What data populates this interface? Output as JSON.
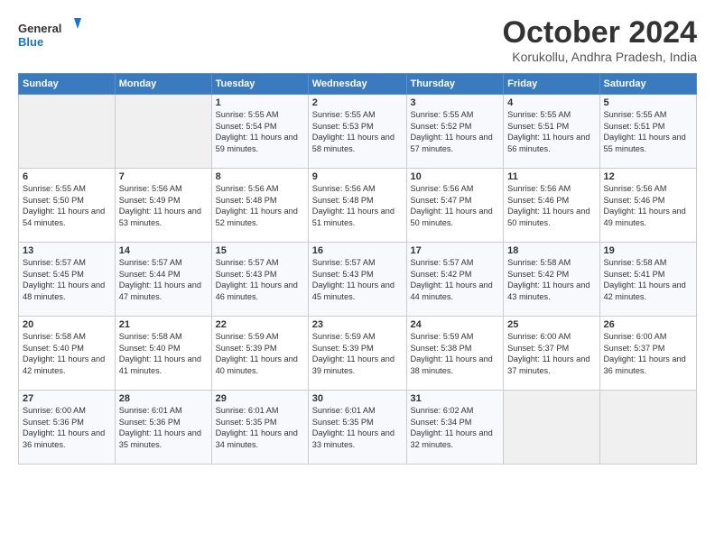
{
  "header": {
    "logo_line1": "General",
    "logo_line2": "Blue",
    "month": "October 2024",
    "location": "Korukollu, Andhra Pradesh, India"
  },
  "days_of_week": [
    "Sunday",
    "Monday",
    "Tuesday",
    "Wednesday",
    "Thursday",
    "Friday",
    "Saturday"
  ],
  "weeks": [
    [
      {
        "num": "",
        "info": ""
      },
      {
        "num": "",
        "info": ""
      },
      {
        "num": "1",
        "info": "Sunrise: 5:55 AM\nSunset: 5:54 PM\nDaylight: 11 hours and 59 minutes."
      },
      {
        "num": "2",
        "info": "Sunrise: 5:55 AM\nSunset: 5:53 PM\nDaylight: 11 hours and 58 minutes."
      },
      {
        "num": "3",
        "info": "Sunrise: 5:55 AM\nSunset: 5:52 PM\nDaylight: 11 hours and 57 minutes."
      },
      {
        "num": "4",
        "info": "Sunrise: 5:55 AM\nSunset: 5:51 PM\nDaylight: 11 hours and 56 minutes."
      },
      {
        "num": "5",
        "info": "Sunrise: 5:55 AM\nSunset: 5:51 PM\nDaylight: 11 hours and 55 minutes."
      }
    ],
    [
      {
        "num": "6",
        "info": "Sunrise: 5:55 AM\nSunset: 5:50 PM\nDaylight: 11 hours and 54 minutes."
      },
      {
        "num": "7",
        "info": "Sunrise: 5:56 AM\nSunset: 5:49 PM\nDaylight: 11 hours and 53 minutes."
      },
      {
        "num": "8",
        "info": "Sunrise: 5:56 AM\nSunset: 5:48 PM\nDaylight: 11 hours and 52 minutes."
      },
      {
        "num": "9",
        "info": "Sunrise: 5:56 AM\nSunset: 5:48 PM\nDaylight: 11 hours and 51 minutes."
      },
      {
        "num": "10",
        "info": "Sunrise: 5:56 AM\nSunset: 5:47 PM\nDaylight: 11 hours and 50 minutes."
      },
      {
        "num": "11",
        "info": "Sunrise: 5:56 AM\nSunset: 5:46 PM\nDaylight: 11 hours and 50 minutes."
      },
      {
        "num": "12",
        "info": "Sunrise: 5:56 AM\nSunset: 5:46 PM\nDaylight: 11 hours and 49 minutes."
      }
    ],
    [
      {
        "num": "13",
        "info": "Sunrise: 5:57 AM\nSunset: 5:45 PM\nDaylight: 11 hours and 48 minutes."
      },
      {
        "num": "14",
        "info": "Sunrise: 5:57 AM\nSunset: 5:44 PM\nDaylight: 11 hours and 47 minutes."
      },
      {
        "num": "15",
        "info": "Sunrise: 5:57 AM\nSunset: 5:43 PM\nDaylight: 11 hours and 46 minutes."
      },
      {
        "num": "16",
        "info": "Sunrise: 5:57 AM\nSunset: 5:43 PM\nDaylight: 11 hours and 45 minutes."
      },
      {
        "num": "17",
        "info": "Sunrise: 5:57 AM\nSunset: 5:42 PM\nDaylight: 11 hours and 44 minutes."
      },
      {
        "num": "18",
        "info": "Sunrise: 5:58 AM\nSunset: 5:42 PM\nDaylight: 11 hours and 43 minutes."
      },
      {
        "num": "19",
        "info": "Sunrise: 5:58 AM\nSunset: 5:41 PM\nDaylight: 11 hours and 42 minutes."
      }
    ],
    [
      {
        "num": "20",
        "info": "Sunrise: 5:58 AM\nSunset: 5:40 PM\nDaylight: 11 hours and 42 minutes."
      },
      {
        "num": "21",
        "info": "Sunrise: 5:58 AM\nSunset: 5:40 PM\nDaylight: 11 hours and 41 minutes."
      },
      {
        "num": "22",
        "info": "Sunrise: 5:59 AM\nSunset: 5:39 PM\nDaylight: 11 hours and 40 minutes."
      },
      {
        "num": "23",
        "info": "Sunrise: 5:59 AM\nSunset: 5:39 PM\nDaylight: 11 hours and 39 minutes."
      },
      {
        "num": "24",
        "info": "Sunrise: 5:59 AM\nSunset: 5:38 PM\nDaylight: 11 hours and 38 minutes."
      },
      {
        "num": "25",
        "info": "Sunrise: 6:00 AM\nSunset: 5:37 PM\nDaylight: 11 hours and 37 minutes."
      },
      {
        "num": "26",
        "info": "Sunrise: 6:00 AM\nSunset: 5:37 PM\nDaylight: 11 hours and 36 minutes."
      }
    ],
    [
      {
        "num": "27",
        "info": "Sunrise: 6:00 AM\nSunset: 5:36 PM\nDaylight: 11 hours and 36 minutes."
      },
      {
        "num": "28",
        "info": "Sunrise: 6:01 AM\nSunset: 5:36 PM\nDaylight: 11 hours and 35 minutes."
      },
      {
        "num": "29",
        "info": "Sunrise: 6:01 AM\nSunset: 5:35 PM\nDaylight: 11 hours and 34 minutes."
      },
      {
        "num": "30",
        "info": "Sunrise: 6:01 AM\nSunset: 5:35 PM\nDaylight: 11 hours and 33 minutes."
      },
      {
        "num": "31",
        "info": "Sunrise: 6:02 AM\nSunset: 5:34 PM\nDaylight: 11 hours and 32 minutes."
      },
      {
        "num": "",
        "info": ""
      },
      {
        "num": "",
        "info": ""
      }
    ]
  ]
}
